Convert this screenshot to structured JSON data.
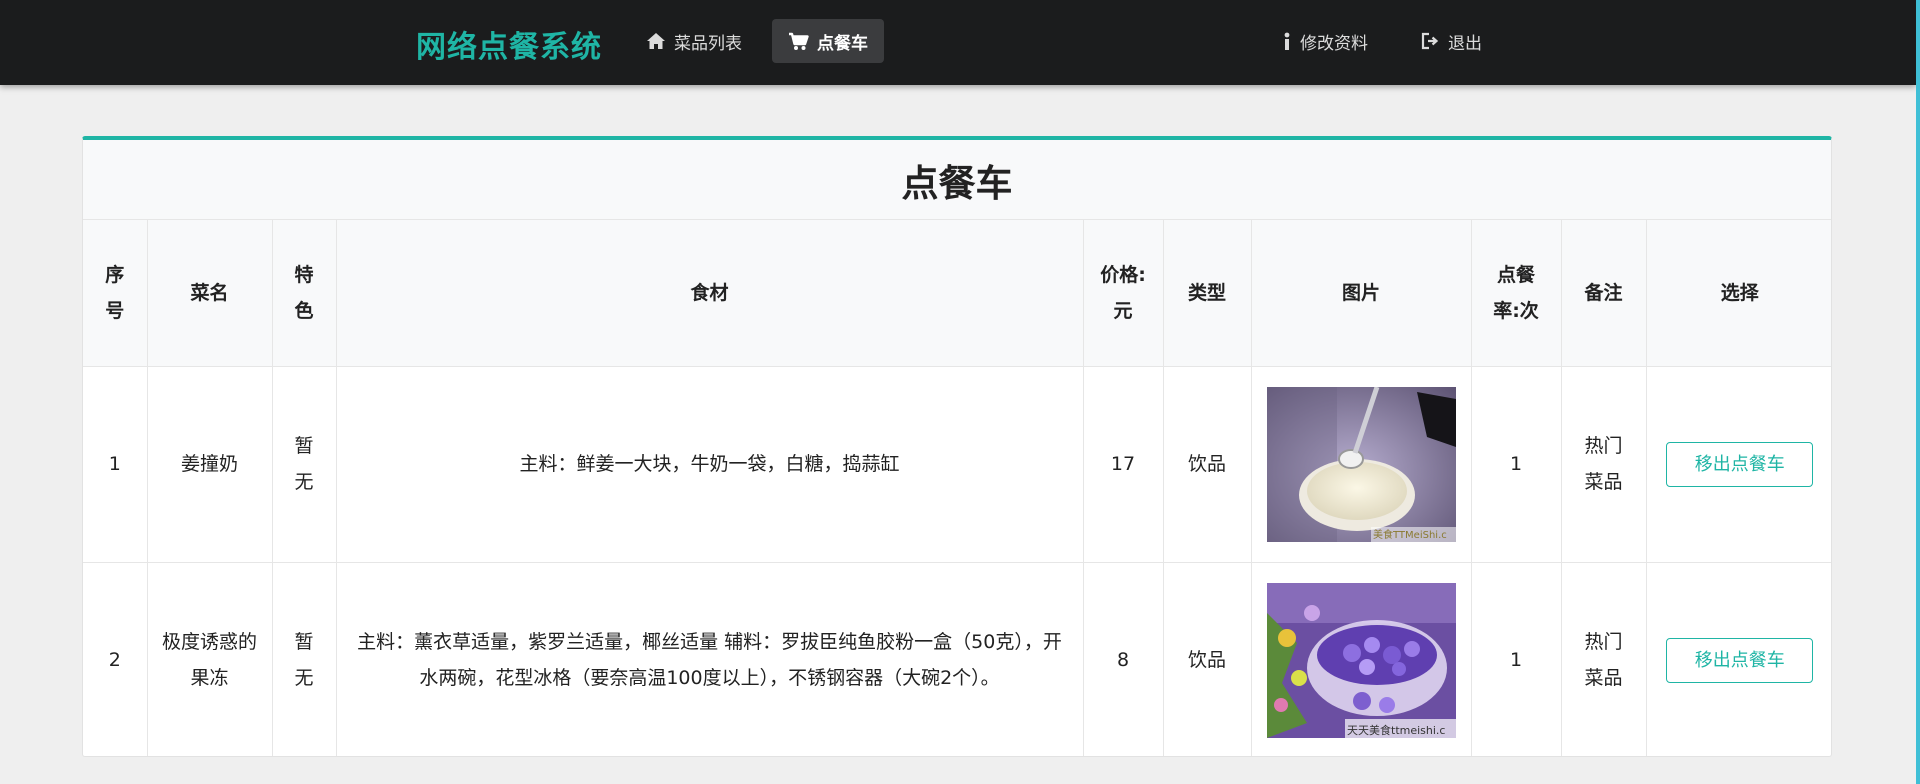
{
  "nav": {
    "brand": "网络点餐系统",
    "menu_list": "菜品列表",
    "cart": "点餐车",
    "edit_profile": "修改资料",
    "logout": "退出"
  },
  "panel": {
    "title": "点餐车"
  },
  "table": {
    "headers": {
      "index": "序号",
      "name": "菜名",
      "feature": "特色",
      "ingredients": "食材",
      "price": "价格:元",
      "type": "类型",
      "image": "图片",
      "order_rate": "点餐率:次",
      "note": "备注",
      "select": "选择"
    },
    "rows": [
      {
        "index": "1",
        "name": "姜撞奶",
        "feature": "暂无",
        "ingredients": "主料：鲜姜一大块，牛奶一袋，白糖，捣蒜缸",
        "price": "17",
        "type": "饮品",
        "image_caption": "美食TTMeiShi.c",
        "order_rate": "1",
        "note": "热门菜品",
        "action": "移出点餐车"
      },
      {
        "index": "2",
        "name": "极度诱惑的果冻",
        "feature": "暂无",
        "ingredients": "主料：薰衣草适量，紫罗兰适量，椰丝适量 辅料：罗拔臣纯鱼胶粉一盒（50克），开水两碗，花型冰格（要奈高温100度以上），不锈钢容器（大碗2个）。",
        "price": "8",
        "type": "饮品",
        "image_caption": "天天美食ttmeishi.c",
        "order_rate": "1",
        "note": "热门菜品",
        "action": "移出点餐车"
      }
    ]
  },
  "colors": {
    "accent": "#1fb5a5",
    "navbar": "#1b1c1d"
  }
}
